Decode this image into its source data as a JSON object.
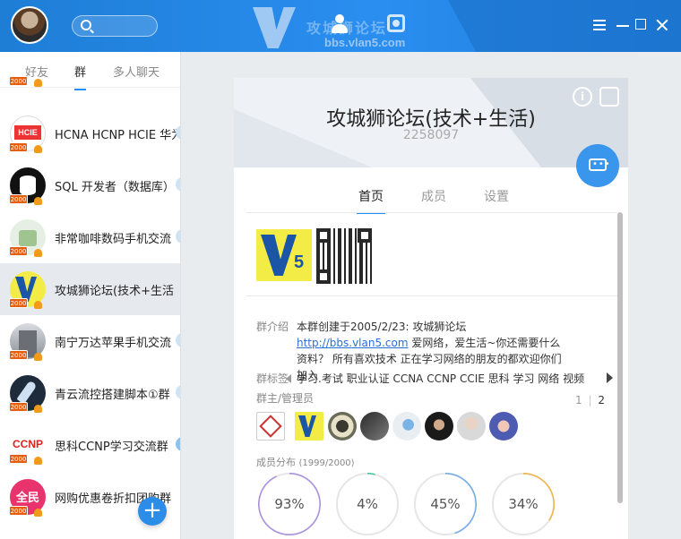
{
  "window": {
    "watermark_name": "攻城狮论坛",
    "watermark_site": "bbs.vlan5.com"
  },
  "sidebar": {
    "tabs": [
      {
        "label": "好友"
      },
      {
        "label": "群"
      },
      {
        "label": "多人聊天"
      }
    ],
    "groups": [
      {
        "name": "HCNA HCNP HCIE 华为",
        "level": "2000",
        "avatar": "hcie"
      },
      {
        "name": "SQL 开发者（数据库）",
        "level": "2000",
        "avatar": "sql"
      },
      {
        "name": "非常咖啡数码手机交流",
        "level": "2000",
        "avatar": "coffee"
      },
      {
        "name": "攻城狮论坛(技术+生活",
        "level": "2000",
        "avatar": "v5"
      },
      {
        "name": "南宁万达苹果手机交流",
        "level": "2000",
        "avatar": "building"
      },
      {
        "name": "青云流控搭建脚本①群",
        "level": "2000",
        "avatar": "rocket"
      },
      {
        "name": "思科CCNP学习交流群",
        "level": "2000",
        "avatar": "ccnp",
        "badge": "5"
      },
      {
        "name": "网购优惠卷折扣团购群",
        "level": "2000",
        "avatar": "quanmin"
      }
    ],
    "add_button": "+"
  },
  "group": {
    "title": "攻城狮论坛(技术+生活)",
    "id": "2258097",
    "tabs": [
      {
        "label": "首页"
      },
      {
        "label": "成员"
      },
      {
        "label": "设置"
      }
    ],
    "intro_label": "群介绍",
    "intro_text_before": "本群创建于2005/2/23:  攻城狮论坛",
    "intro_link": "http://bbs.vlan5.com",
    "intro_text_after": " 爱网络，爱生活~你还需要什么资料？ 所有喜欢技术 正在学习网络的朋友的都欢迎你们加入",
    "tags_label": "群标签",
    "tags": "学习.考试  职业认证  CCNA  CCNP  CCIE  思科  学习  网络  视频",
    "admins_label": "群主/管理员",
    "pager_current": "1",
    "pager_sep": "|",
    "pager_total": "2",
    "dist_label": "成员分布",
    "dist_count": "(1999/2000)",
    "distribution": [
      {
        "text": "93%",
        "value": 93,
        "color": "#a58bdc"
      },
      {
        "text": "4%",
        "value": 4,
        "color": "#34c6a0"
      },
      {
        "text": "45%",
        "value": 45,
        "color": "#6ba8e8"
      },
      {
        "text": "34%",
        "value": 34,
        "color": "#f2b13a"
      }
    ]
  }
}
